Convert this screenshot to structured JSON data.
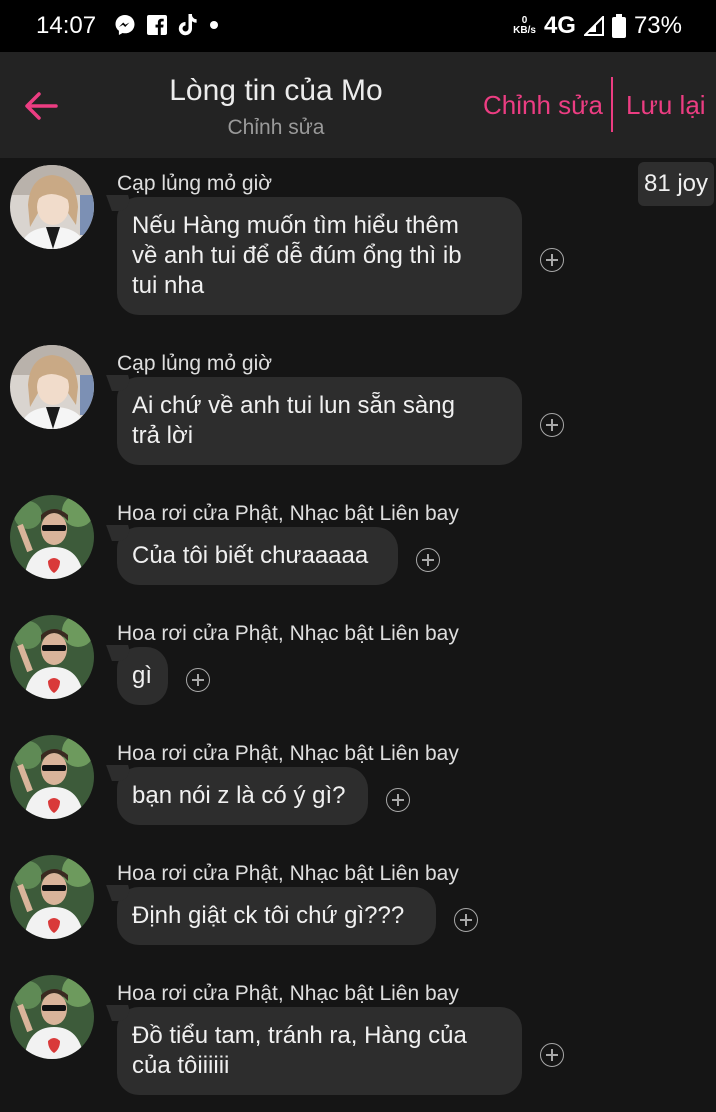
{
  "status_bar": {
    "time": "14:07",
    "icons": [
      "messenger-icon",
      "facebook-icon",
      "tiktok-icon",
      "dot-icon"
    ],
    "speed_value": "0",
    "speed_unit": "KB/s",
    "network": "4G",
    "battery": "73%"
  },
  "header": {
    "title": "Lòng tin của Mo",
    "subtitle": "Chỉnh sửa",
    "edit_label": "Chỉnh sửa",
    "save_label": "Lưu lại",
    "accent_color": "#ec3d82"
  },
  "joy_badge": "81 joy",
  "messages": [
    {
      "sender": "Cạp lủng mỏ giờ",
      "lines": [
        "Nếu Hàng muốn tìm hiểu thêm",
        "về anh tui để dễ đúm ổng thì ib",
        "tui nha"
      ]
    },
    {
      "sender": "Cạp lủng mỏ giờ",
      "lines": [
        "Ai chứ về anh tui lun sẵn sàng",
        "trả lời"
      ]
    },
    {
      "sender": "Hoa rơi cửa Phật, Nhạc bật Liên bay",
      "lines": [
        "Của tôi biết chưaaaaa"
      ]
    },
    {
      "sender": "Hoa rơi cửa Phật, Nhạc bật Liên bay",
      "lines": [
        "gì"
      ]
    },
    {
      "sender": "Hoa rơi cửa Phật, Nhạc bật Liên bay",
      "lines": [
        "bạn nói z là có ý gì?"
      ]
    },
    {
      "sender": "Hoa rơi cửa Phật, Nhạc bật Liên bay",
      "lines": [
        "Định giật ck tôi chứ gì???"
      ]
    },
    {
      "sender": "Hoa rơi cửa Phật, Nhạc bật Liên bay",
      "lines": [
        "Đồ tiểu tam, tránh ra, Hàng của",
        "của tôiiiiii"
      ]
    }
  ]
}
